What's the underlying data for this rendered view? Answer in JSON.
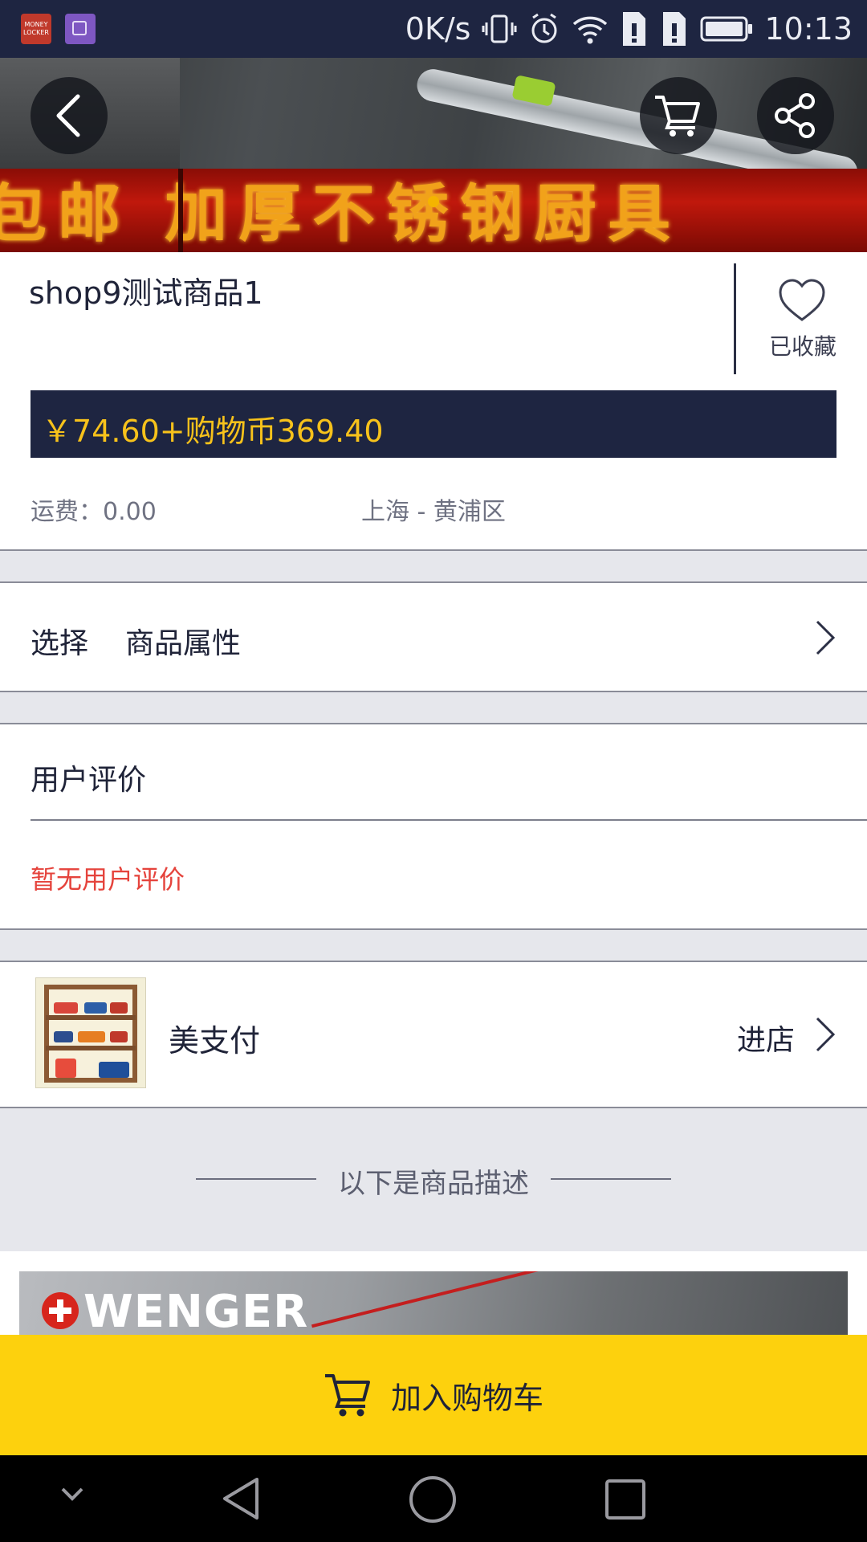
{
  "status_bar": {
    "app_icon_1_text": "MONEY LOCKER",
    "net_speed": "0K/s",
    "time": "10:13"
  },
  "hero": {
    "banner_text": "包邮 加厚不锈钢厨具",
    "dot_color": "#f4b400"
  },
  "product": {
    "title": "shop9测试商品1",
    "favorite_label": "已收藏",
    "price": "￥74.60+购物币369.40",
    "shipping": "运费：0.00",
    "location": "上海 - 黄浦区"
  },
  "options": {
    "select_label": "选择",
    "attr_label": "商品属性"
  },
  "reviews": {
    "heading": "用户评价",
    "empty_text": "暂无用户评价"
  },
  "shop": {
    "name": "美支付",
    "enter_label": "进店"
  },
  "description": {
    "divider_text": "以下是商品描述",
    "image_brand_text": "WENGER"
  },
  "actions": {
    "add_to_cart": "加入购物车"
  },
  "colors": {
    "header_dark": "#1e2541",
    "price_yellow": "#f7c21b",
    "cta_yellow": "#fdd10d",
    "alert_red": "#e5433c"
  }
}
